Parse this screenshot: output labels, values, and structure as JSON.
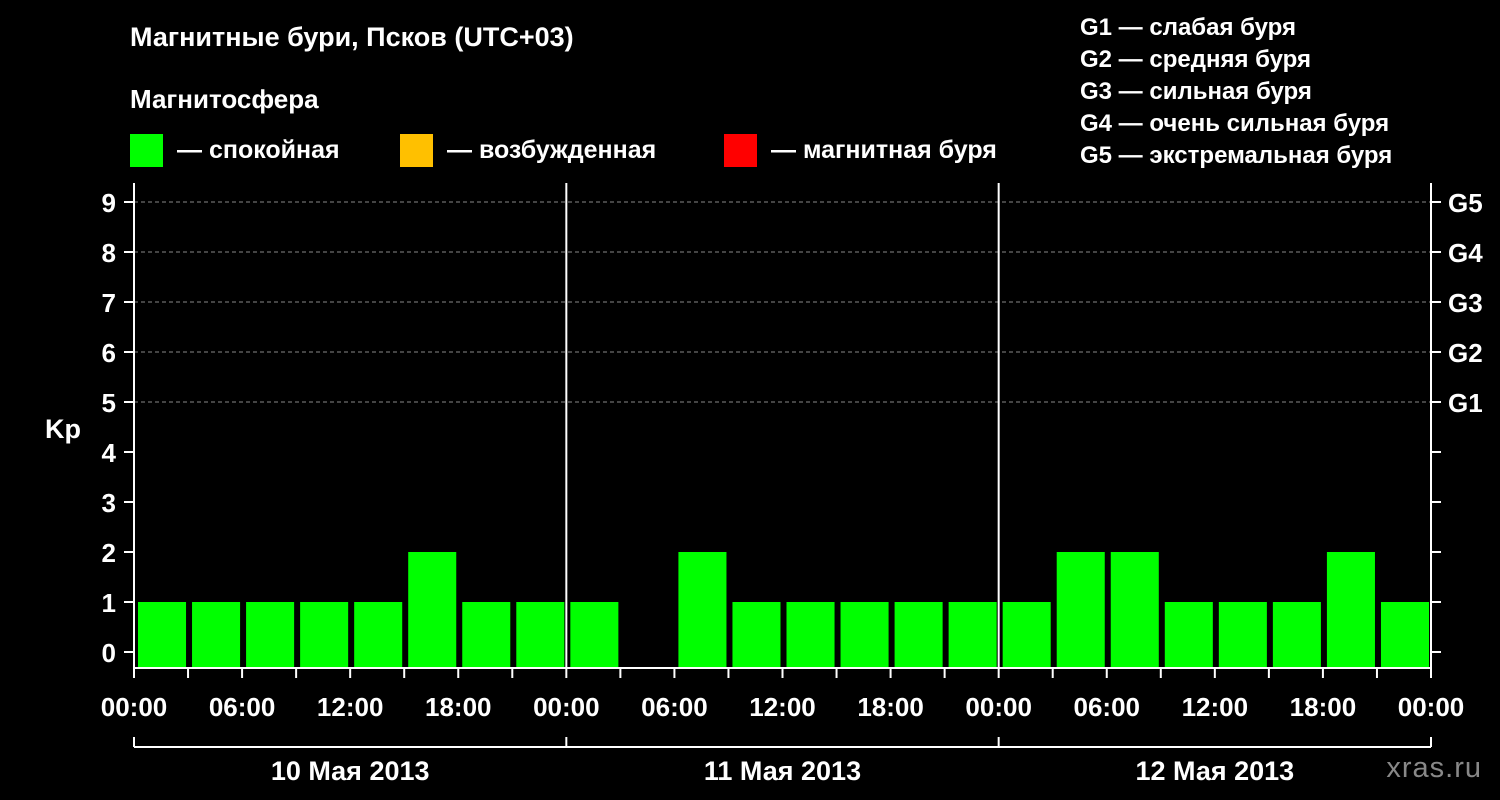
{
  "header": {
    "title": "Магнитные бури, Псков (UTC+03)",
    "subtitle": "Магнитосфера"
  },
  "legend": {
    "items": [
      {
        "label": "— спокойная",
        "color": "#00ff00"
      },
      {
        "label": "— возбужденная",
        "color": "#ffc000"
      },
      {
        "label": "— магнитная буря",
        "color": "#ff0000"
      }
    ]
  },
  "g_scale": [
    "G1 — слабая буря",
    "G2 — средняя буря",
    "G3 — сильная буря",
    "G4 — очень сильная буря",
    "G5 — экстремальная буря"
  ],
  "watermark": "xras.ru",
  "colors": {
    "quiet": "#00ff00",
    "excited": "#ffc000",
    "storm": "#ff0000",
    "background": "#000000",
    "axis": "#ffffff",
    "grid": "#888888"
  },
  "chart_data": {
    "type": "bar",
    "ylabel": "Kp",
    "ylim": [
      0,
      9
    ],
    "y_ticks": [
      "0",
      "1",
      "2",
      "3",
      "4",
      "5",
      "6",
      "7",
      "8",
      "9"
    ],
    "right_ticks": [
      {
        "kp": 5,
        "label": "G1"
      },
      {
        "kp": 6,
        "label": "G2"
      },
      {
        "kp": 7,
        "label": "G3"
      },
      {
        "kp": 8,
        "label": "G4"
      },
      {
        "kp": 9,
        "label": "G5"
      }
    ],
    "grid": "dashed horizontal at Kp 5–9",
    "x_tick_labels": [
      "00:00",
      "06:00",
      "12:00",
      "18:00",
      "00:00",
      "06:00",
      "12:00",
      "18:00",
      "00:00",
      "06:00",
      "12:00",
      "18:00",
      "00:00"
    ],
    "days": [
      "10 Мая 2013",
      "11 Мая 2013",
      "12 Мая 2013"
    ],
    "interval_hours": 3,
    "values": [
      1,
      1,
      1,
      1,
      1,
      2,
      1,
      1,
      1,
      0,
      2,
      1,
      1,
      1,
      1,
      1,
      1,
      2,
      2,
      1,
      1,
      1,
      2,
      1
    ]
  }
}
